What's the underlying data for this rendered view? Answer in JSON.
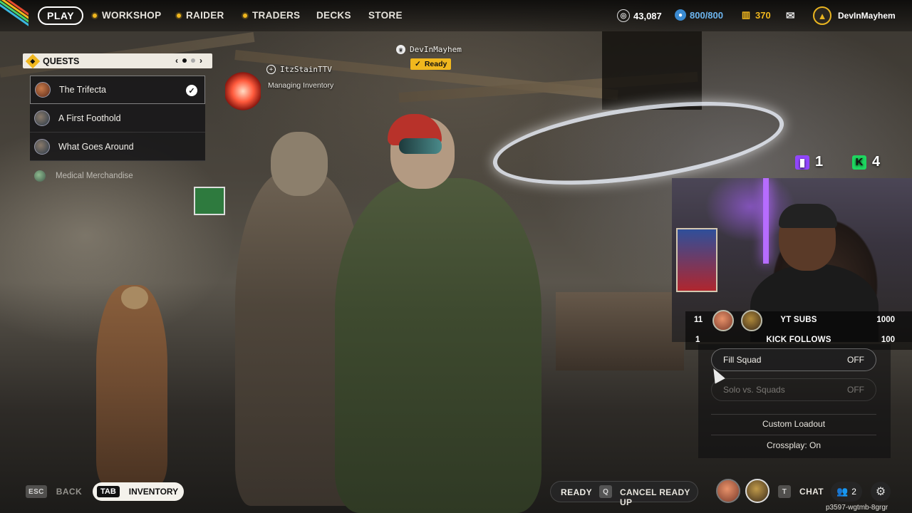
{
  "nav": {
    "play": "PLAY",
    "workshop": "WORKSHOP",
    "raider": "RAIDER",
    "traders": "TRADERS",
    "decks": "DECKS",
    "store": "STORE",
    "accent": "#f0b71e"
  },
  "currency": {
    "coins": "43,087",
    "tokens": "800/800",
    "credits": "370"
  },
  "user": {
    "name": "DevInMayhem"
  },
  "quests": {
    "title": "QUESTS",
    "items": [
      {
        "label": "The Trifecta",
        "completed": true
      },
      {
        "label": "A First Foothold",
        "completed": false
      },
      {
        "label": "What Goes Around",
        "completed": false
      }
    ],
    "extra": "Medical Merchandise"
  },
  "party": {
    "leader_name": "DevInMayhem",
    "leader_status": "Ready",
    "member_name": "ItzStainTTV",
    "member_status": "Managing Inventory"
  },
  "stream": {
    "twitch_count": "1",
    "kick_count": "4",
    "goals": [
      {
        "current": "11",
        "label": "YT SUBS",
        "target": "1000"
      },
      {
        "current": "1",
        "label": "KICK FOLLOWS",
        "target": "100"
      }
    ]
  },
  "squad": {
    "fill_squad_label": "Fill Squad",
    "fill_squad_value": "OFF",
    "solo_label": "Solo vs. Squads",
    "solo_value": "OFF",
    "custom_loadout": "Custom Loadout",
    "crossplay": "Crossplay: On"
  },
  "bottom": {
    "esc_key": "ESC",
    "back": "BACK",
    "tab_key": "TAB",
    "inventory": "INVENTORY",
    "ready": "READY",
    "q_key": "Q",
    "cancel_ready": "CANCEL READY UP",
    "t_key": "T",
    "chat": "CHAT",
    "friends_count": "2"
  },
  "session_id": "p3597-wgtmb-8grgr"
}
